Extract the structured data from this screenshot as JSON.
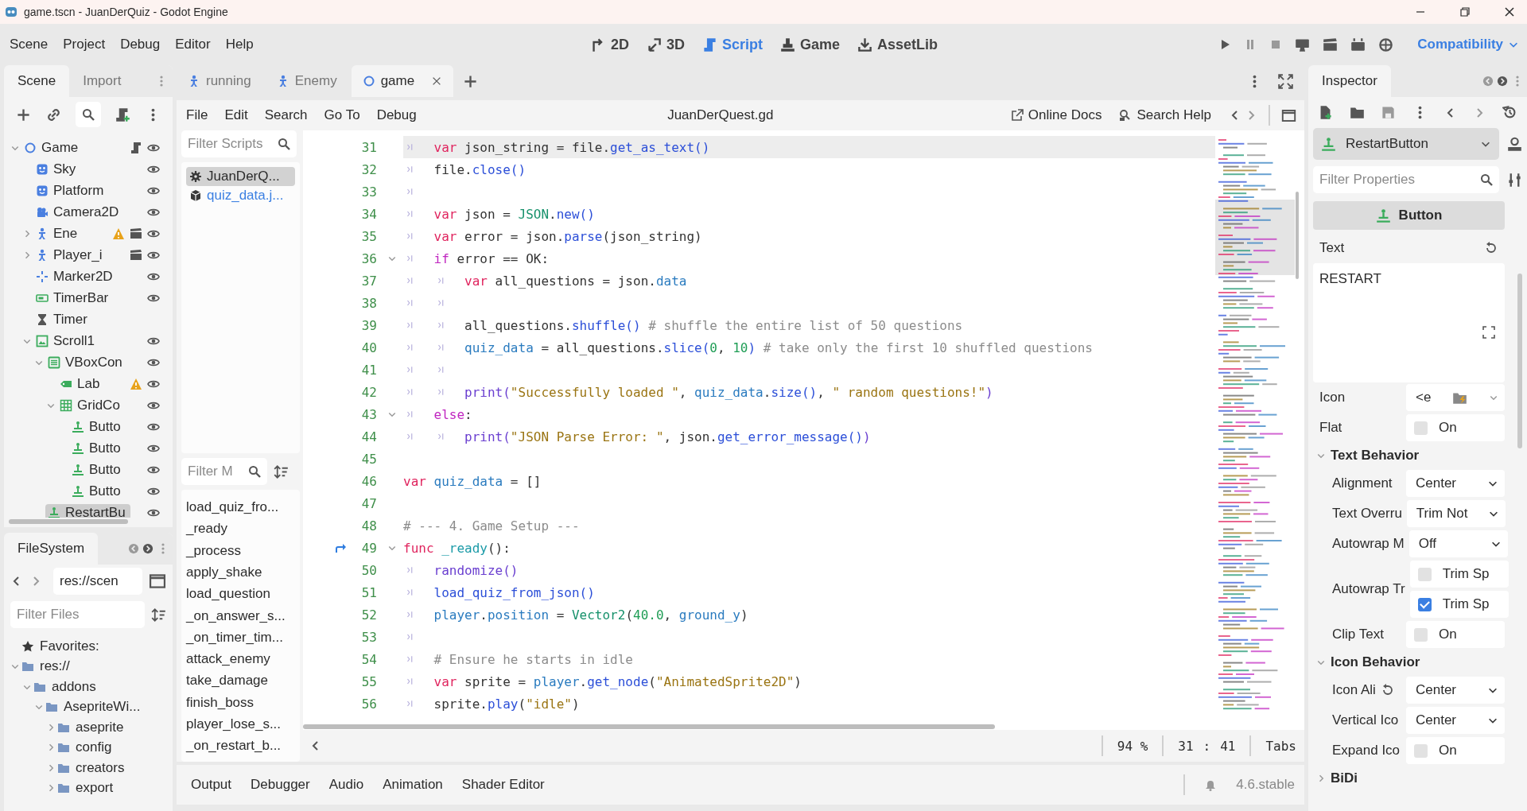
{
  "window": {
    "title": "game.tscn - JuanDerQuiz - Godot Engine"
  },
  "menu": [
    "Scene",
    "Project",
    "Debug",
    "Editor",
    "Help"
  ],
  "main_screens": [
    {
      "label": "2D",
      "kind": "planar",
      "selected": false
    },
    {
      "label": "3D",
      "kind": "spatial",
      "selected": false
    },
    {
      "label": "Script",
      "kind": "script",
      "selected": true
    },
    {
      "label": "Game",
      "kind": "game",
      "selected": false
    },
    {
      "label": "AssetLib",
      "kind": "assetlib",
      "selected": false
    }
  ],
  "renderer": "Compatibility",
  "left_dock": {
    "tabs": [
      {
        "label": "Scene",
        "selected": true
      },
      {
        "label": "Import",
        "selected": false
      }
    ],
    "scene_tree": [
      {
        "name": "Game",
        "kind": "node2d",
        "expanded": true,
        "script": true,
        "warning": false,
        "scene": false,
        "eye": true,
        "selected": false,
        "children": [
          {
            "name": "Sky",
            "kind": "sprite",
            "script": false,
            "warning": false,
            "scene": false,
            "eye": true,
            "selected": false
          },
          {
            "name": "Platform",
            "kind": "sprite",
            "script": false,
            "warning": false,
            "scene": false,
            "eye": true,
            "selected": false
          },
          {
            "name": "Camera2D",
            "kind": "camera",
            "script": false,
            "warning": false,
            "scene": false,
            "eye": true,
            "selected": false
          },
          {
            "name": "Ene",
            "kind": "character",
            "expanded": false,
            "script": false,
            "warning": true,
            "scene": true,
            "eye": true,
            "selected": false
          },
          {
            "name": "Player_i",
            "kind": "character",
            "expanded": false,
            "script": false,
            "warning": false,
            "scene": true,
            "eye": true,
            "selected": false
          },
          {
            "name": "Marker2D",
            "kind": "marker",
            "script": false,
            "warning": false,
            "scene": false,
            "eye": true,
            "selected": false
          },
          {
            "name": "TimerBar",
            "kind": "progress",
            "script": false,
            "warning": false,
            "scene": false,
            "eye": true,
            "selected": false
          },
          {
            "name": "Timer",
            "kind": "timer",
            "script": false,
            "warning": false,
            "scene": false,
            "eye": false,
            "selected": false
          },
          {
            "name": "Scroll1",
            "kind": "scroll",
            "expanded": true,
            "script": false,
            "warning": false,
            "scene": false,
            "eye": true,
            "selected": false,
            "children": [
              {
                "name": "VBoxCon",
                "kind": "vbox",
                "expanded": true,
                "script": false,
                "warning": false,
                "scene": false,
                "eye": true,
                "selected": false,
                "children": [
                  {
                    "name": "Lab",
                    "kind": "label",
                    "script": false,
                    "warning": true,
                    "scene": false,
                    "eye": true,
                    "selected": false
                  },
                  {
                    "name": "GridCo",
                    "kind": "grid",
                    "expanded": true,
                    "script": false,
                    "warning": false,
                    "scene": false,
                    "eye": true,
                    "selected": false,
                    "children": [
                      {
                        "name": "Butto",
                        "kind": "button",
                        "script": false,
                        "warning": false,
                        "scene": false,
                        "eye": true,
                        "selected": false
                      },
                      {
                        "name": "Butto",
                        "kind": "button",
                        "script": false,
                        "warning": false,
                        "scene": false,
                        "eye": true,
                        "selected": false
                      },
                      {
                        "name": "Butto",
                        "kind": "button",
                        "script": false,
                        "warning": false,
                        "scene": false,
                        "eye": true,
                        "selected": false
                      },
                      {
                        "name": "Butto",
                        "kind": "button",
                        "script": false,
                        "warning": false,
                        "scene": false,
                        "eye": true,
                        "selected": false
                      }
                    ]
                  }
                ]
              },
              {
                "name": "RestartBu",
                "kind": "button",
                "script": false,
                "warning": false,
                "scene": false,
                "eye": true,
                "selected": true
              }
            ]
          }
        ]
      }
    ]
  },
  "filesystem": {
    "title": "FileSystem",
    "path": "res://scen",
    "filter_placeholder": "Filter Files",
    "tree": [
      {
        "name": "Favorites:",
        "kind": "star"
      },
      {
        "name": "res://",
        "kind": "folder",
        "expanded": true,
        "children": [
          {
            "name": "addons",
            "kind": "folder",
            "expanded": true,
            "children": [
              {
                "name": "AsepriteWi...",
                "kind": "folder",
                "expanded": true,
                "children": [
                  {
                    "name": "aseprite",
                    "kind": "folder",
                    "expanded": false
                  },
                  {
                    "name": "config",
                    "kind": "folder",
                    "expanded": false
                  },
                  {
                    "name": "creators",
                    "kind": "folder",
                    "expanded": false
                  },
                  {
                    "name": "export",
                    "kind": "folder",
                    "expanded": false
                  }
                ]
              }
            ]
          }
        ]
      }
    ]
  },
  "editor_tabs": [
    {
      "label": "running",
      "kind": "character",
      "selected": false
    },
    {
      "label": "Enemy",
      "kind": "character",
      "selected": false
    },
    {
      "label": "game",
      "kind": "node2d",
      "selected": true
    }
  ],
  "script_editor": {
    "menu": [
      "File",
      "Edit",
      "Search",
      "Go To",
      "Debug"
    ],
    "file_name": "JuanDerQuest.gd",
    "links": [
      {
        "label": "Online Docs",
        "kind": "external"
      },
      {
        "label": "Search Help",
        "kind": "help"
      }
    ],
    "script_filter_placeholder": "Filter Scripts",
    "scripts": [
      {
        "name": "JuanDerQ...",
        "kind": "gear",
        "selected": true
      },
      {
        "name": "quiz_data.j...",
        "kind": "cube",
        "selected": false
      }
    ],
    "method_filter_placeholder": "Filter M",
    "methods": [
      "load_quiz_fro...",
      "_ready",
      "_process",
      "apply_shake",
      "load_question",
      "_on_answer_s...",
      "_on_timer_tim...",
      "attack_enemy",
      "take_damage",
      "finish_boss",
      "player_lose_s...",
      "_on_restart_b..."
    ],
    "lines": [
      {
        "n": "31",
        "fold": false,
        "selected": true,
        "override": false,
        "tokens": [
          {
            "kind": "tab"
          },
          {
            "kind": "kw",
            "text": "var"
          },
          {
            "kind": "p",
            "text": " json_string = file."
          },
          {
            "kind": "fn",
            "text": "get_as_text()"
          }
        ]
      },
      {
        "n": "32",
        "fold": false,
        "selected": false,
        "override": false,
        "tokens": [
          {
            "kind": "tab"
          },
          {
            "kind": "p",
            "text": "file."
          },
          {
            "kind": "fn",
            "text": "close()"
          }
        ]
      },
      {
        "n": "33",
        "fold": false,
        "selected": false,
        "override": false,
        "tokens": [
          {
            "kind": "tab"
          }
        ]
      },
      {
        "n": "34",
        "fold": false,
        "selected": false,
        "override": false,
        "tokens": [
          {
            "kind": "tab"
          },
          {
            "kind": "kw",
            "text": "var"
          },
          {
            "kind": "p",
            "text": " json = "
          },
          {
            "kind": "type",
            "text": "JSON"
          },
          {
            "kind": "p",
            "text": "."
          },
          {
            "kind": "fn",
            "text": "new()"
          }
        ]
      },
      {
        "n": "35",
        "fold": false,
        "selected": false,
        "override": false,
        "tokens": [
          {
            "kind": "tab"
          },
          {
            "kind": "kw",
            "text": "var"
          },
          {
            "kind": "p",
            "text": " error = json."
          },
          {
            "kind": "fn",
            "text": "parse"
          },
          {
            "kind": "p",
            "text": "(json_string)"
          }
        ]
      },
      {
        "n": "36",
        "fold": true,
        "selected": false,
        "override": false,
        "tokens": [
          {
            "kind": "tab"
          },
          {
            "kind": "ctl",
            "text": "if"
          },
          {
            "kind": "p",
            "text": " error == OK:"
          }
        ]
      },
      {
        "n": "37",
        "fold": false,
        "selected": false,
        "override": false,
        "tokens": [
          {
            "kind": "tab"
          },
          {
            "kind": "tab"
          },
          {
            "kind": "kw",
            "text": "var"
          },
          {
            "kind": "p",
            "text": " all_questions = json."
          },
          {
            "kind": "mem",
            "text": "data"
          }
        ]
      },
      {
        "n": "38",
        "fold": false,
        "selected": false,
        "override": false,
        "tokens": [
          {
            "kind": "tab"
          },
          {
            "kind": "tab"
          }
        ]
      },
      {
        "n": "39",
        "fold": false,
        "selected": false,
        "override": false,
        "tokens": [
          {
            "kind": "tab"
          },
          {
            "kind": "tab"
          },
          {
            "kind": "p",
            "text": "all_questions."
          },
          {
            "kind": "fn",
            "text": "shuffle()"
          },
          {
            "kind": "com",
            "text": " # shuffle the entire list of 50 questions"
          }
        ]
      },
      {
        "n": "40",
        "fold": false,
        "selected": false,
        "override": false,
        "tokens": [
          {
            "kind": "tab"
          },
          {
            "kind": "tab"
          },
          {
            "kind": "mem",
            "text": "quiz_data"
          },
          {
            "kind": "p",
            "text": " = all_questions."
          },
          {
            "kind": "fn",
            "text": "slice("
          },
          {
            "kind": "num",
            "text": "0"
          },
          {
            "kind": "p",
            "text": ", "
          },
          {
            "kind": "num",
            "text": "10"
          },
          {
            "kind": "fn",
            "text": ")"
          },
          {
            "kind": "com",
            "text": " # take only the first 10 shuffled questions"
          }
        ]
      },
      {
        "n": "41",
        "fold": false,
        "selected": false,
        "override": false,
        "tokens": [
          {
            "kind": "tab"
          },
          {
            "kind": "tab"
          }
        ]
      },
      {
        "n": "42",
        "fold": false,
        "selected": false,
        "override": false,
        "tokens": [
          {
            "kind": "tab"
          },
          {
            "kind": "tab"
          },
          {
            "kind": "bi",
            "text": "print("
          },
          {
            "kind": "str",
            "text": "\"Successfully loaded \""
          },
          {
            "kind": "p",
            "text": ", "
          },
          {
            "kind": "mem",
            "text": "quiz_data"
          },
          {
            "kind": "p",
            "text": "."
          },
          {
            "kind": "fn",
            "text": "size()"
          },
          {
            "kind": "p",
            "text": ", "
          },
          {
            "kind": "str",
            "text": "\" random questions!\""
          },
          {
            "kind": "bi",
            "text": ")"
          }
        ]
      },
      {
        "n": "43",
        "fold": true,
        "selected": false,
        "override": false,
        "tokens": [
          {
            "kind": "tab"
          },
          {
            "kind": "ctl",
            "text": "else"
          },
          {
            "kind": "p",
            "text": ":"
          }
        ]
      },
      {
        "n": "44",
        "fold": false,
        "selected": false,
        "override": false,
        "tokens": [
          {
            "kind": "tab"
          },
          {
            "kind": "tab"
          },
          {
            "kind": "bi",
            "text": "print("
          },
          {
            "kind": "str",
            "text": "\"JSON Parse Error: \""
          },
          {
            "kind": "p",
            "text": ", json."
          },
          {
            "kind": "fn",
            "text": "get_error_message()"
          },
          {
            "kind": "bi",
            "text": ")"
          }
        ]
      },
      {
        "n": "45",
        "fold": false,
        "selected": false,
        "override": false
      },
      {
        "n": "46",
        "fold": false,
        "selected": false,
        "override": false,
        "tokens": [
          {
            "kind": "kw",
            "text": "var "
          },
          {
            "kind": "mem",
            "text": "quiz_data"
          },
          {
            "kind": "p",
            "text": " = []"
          }
        ]
      },
      {
        "n": "47",
        "fold": false,
        "selected": false,
        "override": false
      },
      {
        "n": "48",
        "fold": false,
        "selected": false,
        "override": false,
        "tokens": [
          {
            "kind": "com",
            "text": "# --- 4. Game Setup ---"
          }
        ]
      },
      {
        "n": "49",
        "fold": true,
        "selected": false,
        "override": true,
        "tokens": [
          {
            "kind": "kw",
            "text": "func "
          },
          {
            "kind": "def",
            "text": "_ready"
          },
          {
            "kind": "p",
            "text": "():"
          }
        ]
      },
      {
        "n": "50",
        "fold": false,
        "selected": false,
        "override": false,
        "tokens": [
          {
            "kind": "tab"
          },
          {
            "kind": "bi",
            "text": "randomize()"
          }
        ]
      },
      {
        "n": "51",
        "fold": false,
        "selected": false,
        "override": false,
        "tokens": [
          {
            "kind": "tab"
          },
          {
            "kind": "fn",
            "text": "load_quiz_from_json()"
          }
        ]
      },
      {
        "n": "52",
        "fold": false,
        "selected": false,
        "override": false,
        "tokens": [
          {
            "kind": "tab"
          },
          {
            "kind": "mem",
            "text": "player"
          },
          {
            "kind": "p",
            "text": "."
          },
          {
            "kind": "mem",
            "text": "position"
          },
          {
            "kind": "p",
            "text": " = "
          },
          {
            "kind": "type",
            "text": "Vector2"
          },
          {
            "kind": "p",
            "text": "("
          },
          {
            "kind": "num",
            "text": "40.0"
          },
          {
            "kind": "p",
            "text": ", "
          },
          {
            "kind": "mem",
            "text": "ground_y"
          },
          {
            "kind": "p",
            "text": ")"
          }
        ]
      },
      {
        "n": "53",
        "fold": false,
        "selected": false,
        "override": false,
        "tokens": [
          {
            "kind": "tab"
          }
        ]
      },
      {
        "n": "54",
        "fold": false,
        "selected": false,
        "override": false,
        "tokens": [
          {
            "kind": "tab"
          },
          {
            "kind": "com",
            "text": "# Ensure he starts in idle"
          }
        ]
      },
      {
        "n": "55",
        "fold": false,
        "selected": false,
        "override": false,
        "tokens": [
          {
            "kind": "tab"
          },
          {
            "kind": "kw",
            "text": "var"
          },
          {
            "kind": "p",
            "text": " sprite = "
          },
          {
            "kind": "mem",
            "text": "player"
          },
          {
            "kind": "p",
            "text": "."
          },
          {
            "kind": "fn",
            "text": "get_node"
          },
          {
            "kind": "p",
            "text": "("
          },
          {
            "kind": "str",
            "text": "\"AnimatedSprite2D\""
          },
          {
            "kind": "p",
            "text": ")"
          }
        ]
      },
      {
        "n": "56",
        "fold": false,
        "selected": false,
        "override": false,
        "tokens": [
          {
            "kind": "tab"
          },
          {
            "kind": "p",
            "text": "sprite."
          },
          {
            "kind": "fn",
            "text": "play"
          },
          {
            "kind": "p",
            "text": "("
          },
          {
            "kind": "str",
            "text": "\"idle\""
          },
          {
            "kind": "p",
            "text": ")"
          }
        ]
      }
    ],
    "status": {
      "zoom": "94 %",
      "line": "31",
      "separator": ":",
      "column": "41",
      "indent": "Tabs"
    }
  },
  "bottom_panel": {
    "tabs": [
      "Output",
      "Debugger",
      "Audio",
      "Animation",
      "Shader Editor"
    ],
    "version": "4.6.stable"
  },
  "inspector": {
    "tab": "Inspector",
    "node": "RestartButton",
    "filter_placeholder": "Filter Properties",
    "class": "Button",
    "properties": [
      {
        "kind": "text",
        "label": "Text",
        "value": "RESTART",
        "revert": true
      },
      {
        "kind": "resource",
        "label": "Icon",
        "value": "<e"
      },
      {
        "kind": "check",
        "label": "Flat",
        "text": "On",
        "checked": false
      },
      {
        "kind": "section",
        "label": "Text Behavior",
        "expanded": true,
        "children": [
          {
            "kind": "dropdown",
            "label": "Alignment",
            "value": "Center",
            "revert": false
          },
          {
            "kind": "dropdown",
            "label": "Text Overru",
            "value": "Trim Not",
            "revert": false
          },
          {
            "kind": "dropdown",
            "label": "Autowrap M",
            "value": "Off",
            "revert": false
          },
          {
            "kind": "checks",
            "label": "Autowrap Tr",
            "options": [
              {
                "text": "Trim Sp",
                "checked": false
              },
              {
                "text": "Trim Sp",
                "checked": true
              }
            ]
          },
          {
            "kind": "check",
            "label": "Clip Text",
            "text": "On",
            "checked": false
          }
        ]
      },
      {
        "kind": "section",
        "label": "Icon Behavior",
        "expanded": true,
        "children": [
          {
            "kind": "dropdown",
            "label": "Icon Ali",
            "value": "Center",
            "revert": true
          },
          {
            "kind": "dropdown",
            "label": "Vertical Ico",
            "value": "Center",
            "revert": false
          },
          {
            "kind": "check",
            "label": "Expand Ico",
            "text": "On",
            "checked": false
          }
        ]
      },
      {
        "kind": "section",
        "label": "BiDi",
        "expanded": false
      }
    ]
  }
}
